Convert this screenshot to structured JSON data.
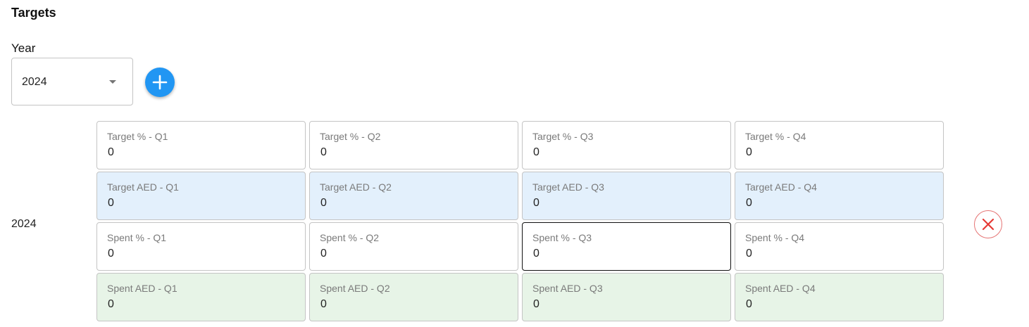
{
  "section_title": "Targets",
  "year_field": {
    "label": "Year",
    "value": "2024"
  },
  "icons": {
    "add": "plus-icon",
    "delete": "close-circle-icon",
    "dropdown": "chevron-down-icon"
  },
  "colors": {
    "accent": "#2196f3",
    "target_aed_bg": "#e3f0fc",
    "spent_aed_bg": "#e7f4e7",
    "delete": "#e53935"
  },
  "targets_row": {
    "year": "2024",
    "target_pct": [
      {
        "label": "Target % - Q1",
        "value": "0"
      },
      {
        "label": "Target % - Q2",
        "value": "0"
      },
      {
        "label": "Target % - Q3",
        "value": "0"
      },
      {
        "label": "Target % - Q4",
        "value": "0"
      }
    ],
    "target_aed": [
      {
        "label": "Target AED - Q1",
        "value": "0"
      },
      {
        "label": "Target AED - Q2",
        "value": "0"
      },
      {
        "label": "Target AED - Q3",
        "value": "0"
      },
      {
        "label": "Target AED - Q4",
        "value": "0"
      }
    ],
    "spent_pct": [
      {
        "label": "Spent % - Q1",
        "value": "0"
      },
      {
        "label": "Spent % - Q2",
        "value": "0"
      },
      {
        "label": "Spent % - Q3",
        "value": "0"
      },
      {
        "label": "Spent % - Q4",
        "value": "0"
      }
    ],
    "spent_aed": [
      {
        "label": "Spent AED - Q1",
        "value": "0"
      },
      {
        "label": "Spent AED - Q2",
        "value": "0"
      },
      {
        "label": "Spent AED - Q3",
        "value": "0"
      },
      {
        "label": "Spent AED - Q4",
        "value": "0"
      }
    ]
  }
}
